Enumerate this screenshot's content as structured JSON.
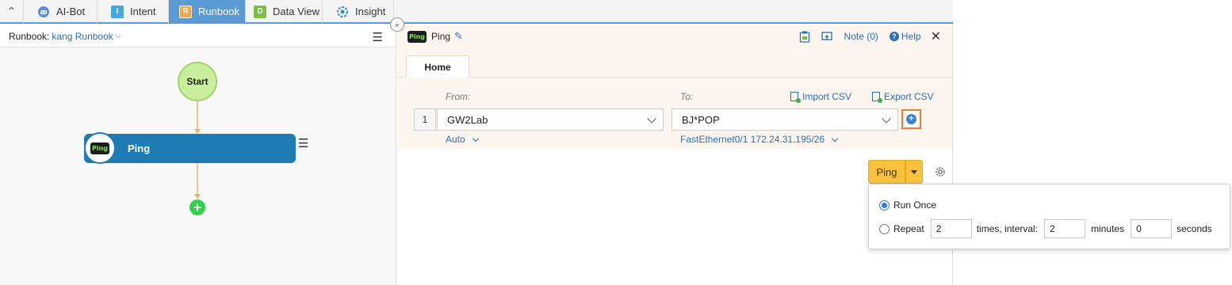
{
  "tabs": [
    {
      "label": "AI-Bot",
      "icon": "ai-bot-icon"
    },
    {
      "label": "Intent",
      "icon": "intent-icon",
      "glyph": "I"
    },
    {
      "label": "Runbook",
      "icon": "runbook-icon",
      "glyph": "R"
    },
    {
      "label": "Data View",
      "icon": "data-view-icon",
      "glyph": "D"
    },
    {
      "label": "Insight",
      "icon": "insight-icon"
    }
  ],
  "active_tab": "Runbook",
  "runbook": {
    "label": "Runbook:",
    "name": "kang Runbook"
  },
  "flow": {
    "start_label": "Start",
    "node_label": "Ping",
    "node_badge": "Ping"
  },
  "panel": {
    "title": "Ping",
    "badge": "Ping",
    "note": "Note (0)",
    "help": "Help",
    "tab_home": "Home"
  },
  "pair": {
    "from_label": "From:",
    "to_label": "To:",
    "import_csv": "Import CSV",
    "export_csv": "Export CSV",
    "row_number": "1",
    "from_value": "GW2Lab",
    "to_value": "BJ*POP",
    "from_sub": "Auto",
    "to_sub": "FastEthernet0/1 172.24.31.195/26"
  },
  "action": {
    "ping_button": "Ping"
  },
  "run_options": {
    "run_once": "Run Once",
    "repeat": "Repeat",
    "times": "2",
    "times_label": "times, interval:",
    "minutes": "2",
    "minutes_label": "minutes",
    "seconds": "0",
    "seconds_label": "seconds",
    "selected": "Run Once"
  },
  "colors": {
    "tab_active": "#5b9bd5",
    "node_blue": "#1e7bb4",
    "start_green": "#c9ef9d",
    "add_green": "#2fd34a",
    "ping_yellow": "#f9c23c",
    "highlight_orange": "#f37b2a",
    "link_blue": "#2a6fb5"
  }
}
